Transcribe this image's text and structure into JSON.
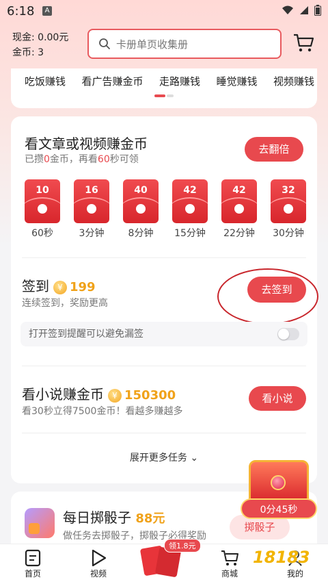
{
  "status": {
    "time": "6:18",
    "badge": "A"
  },
  "wallet": {
    "cash": "现金: 0.00元",
    "coins": "金币: 3"
  },
  "search": {
    "placeholder": "卡册单页收集册"
  },
  "categories": [
    "吃饭赚钱",
    "看广告赚金币",
    "走路赚钱",
    "睡觉赚钱",
    "视频赚钱"
  ],
  "task_article": {
    "title": "看文章或视频赚金币",
    "sub_pre": "已攒",
    "sub_coins": "0",
    "sub_mid": "金币，再看",
    "sub_secs": "60",
    "sub_post": "秒可领",
    "button": "去翻倍",
    "envelopes": [
      {
        "num": "10",
        "label": "60秒"
      },
      {
        "num": "16",
        "label": "3分钟"
      },
      {
        "num": "40",
        "label": "8分钟"
      },
      {
        "num": "42",
        "label": "15分钟"
      },
      {
        "num": "42",
        "label": "22分钟"
      },
      {
        "num": "32",
        "label": "30分钟"
      }
    ]
  },
  "task_checkin": {
    "title": "签到",
    "coin_symbol": "¥",
    "amount": "199",
    "sub": "连续签到，奖励更高",
    "button": "去签到",
    "reminder": "打开签到提醒可以避免漏签",
    "reminder_on": false
  },
  "task_novel": {
    "title": "看小说赚金币",
    "coin_symbol": "¥",
    "amount": "150300",
    "sub": "看30秒立得7500金币！看越多赚越多",
    "button": "看小说"
  },
  "expand": {
    "label": "展开更多任务",
    "chevron": "⌄"
  },
  "dice": {
    "title": "每日掷骰子",
    "amount": "88元",
    "sub": "做任务去掷骰子，掷骰子必得奖励",
    "button": "掷骰子"
  },
  "chest": {
    "timer": "0分45秒"
  },
  "nav": {
    "home": "首页",
    "video": "视频",
    "center_badge": "领1.8元",
    "mall": "商城",
    "mine": "我的"
  },
  "watermark": "18183",
  "colors": {
    "accent": "#e8494e",
    "gold": "#f0a21a",
    "annotation": "#c8262c"
  }
}
